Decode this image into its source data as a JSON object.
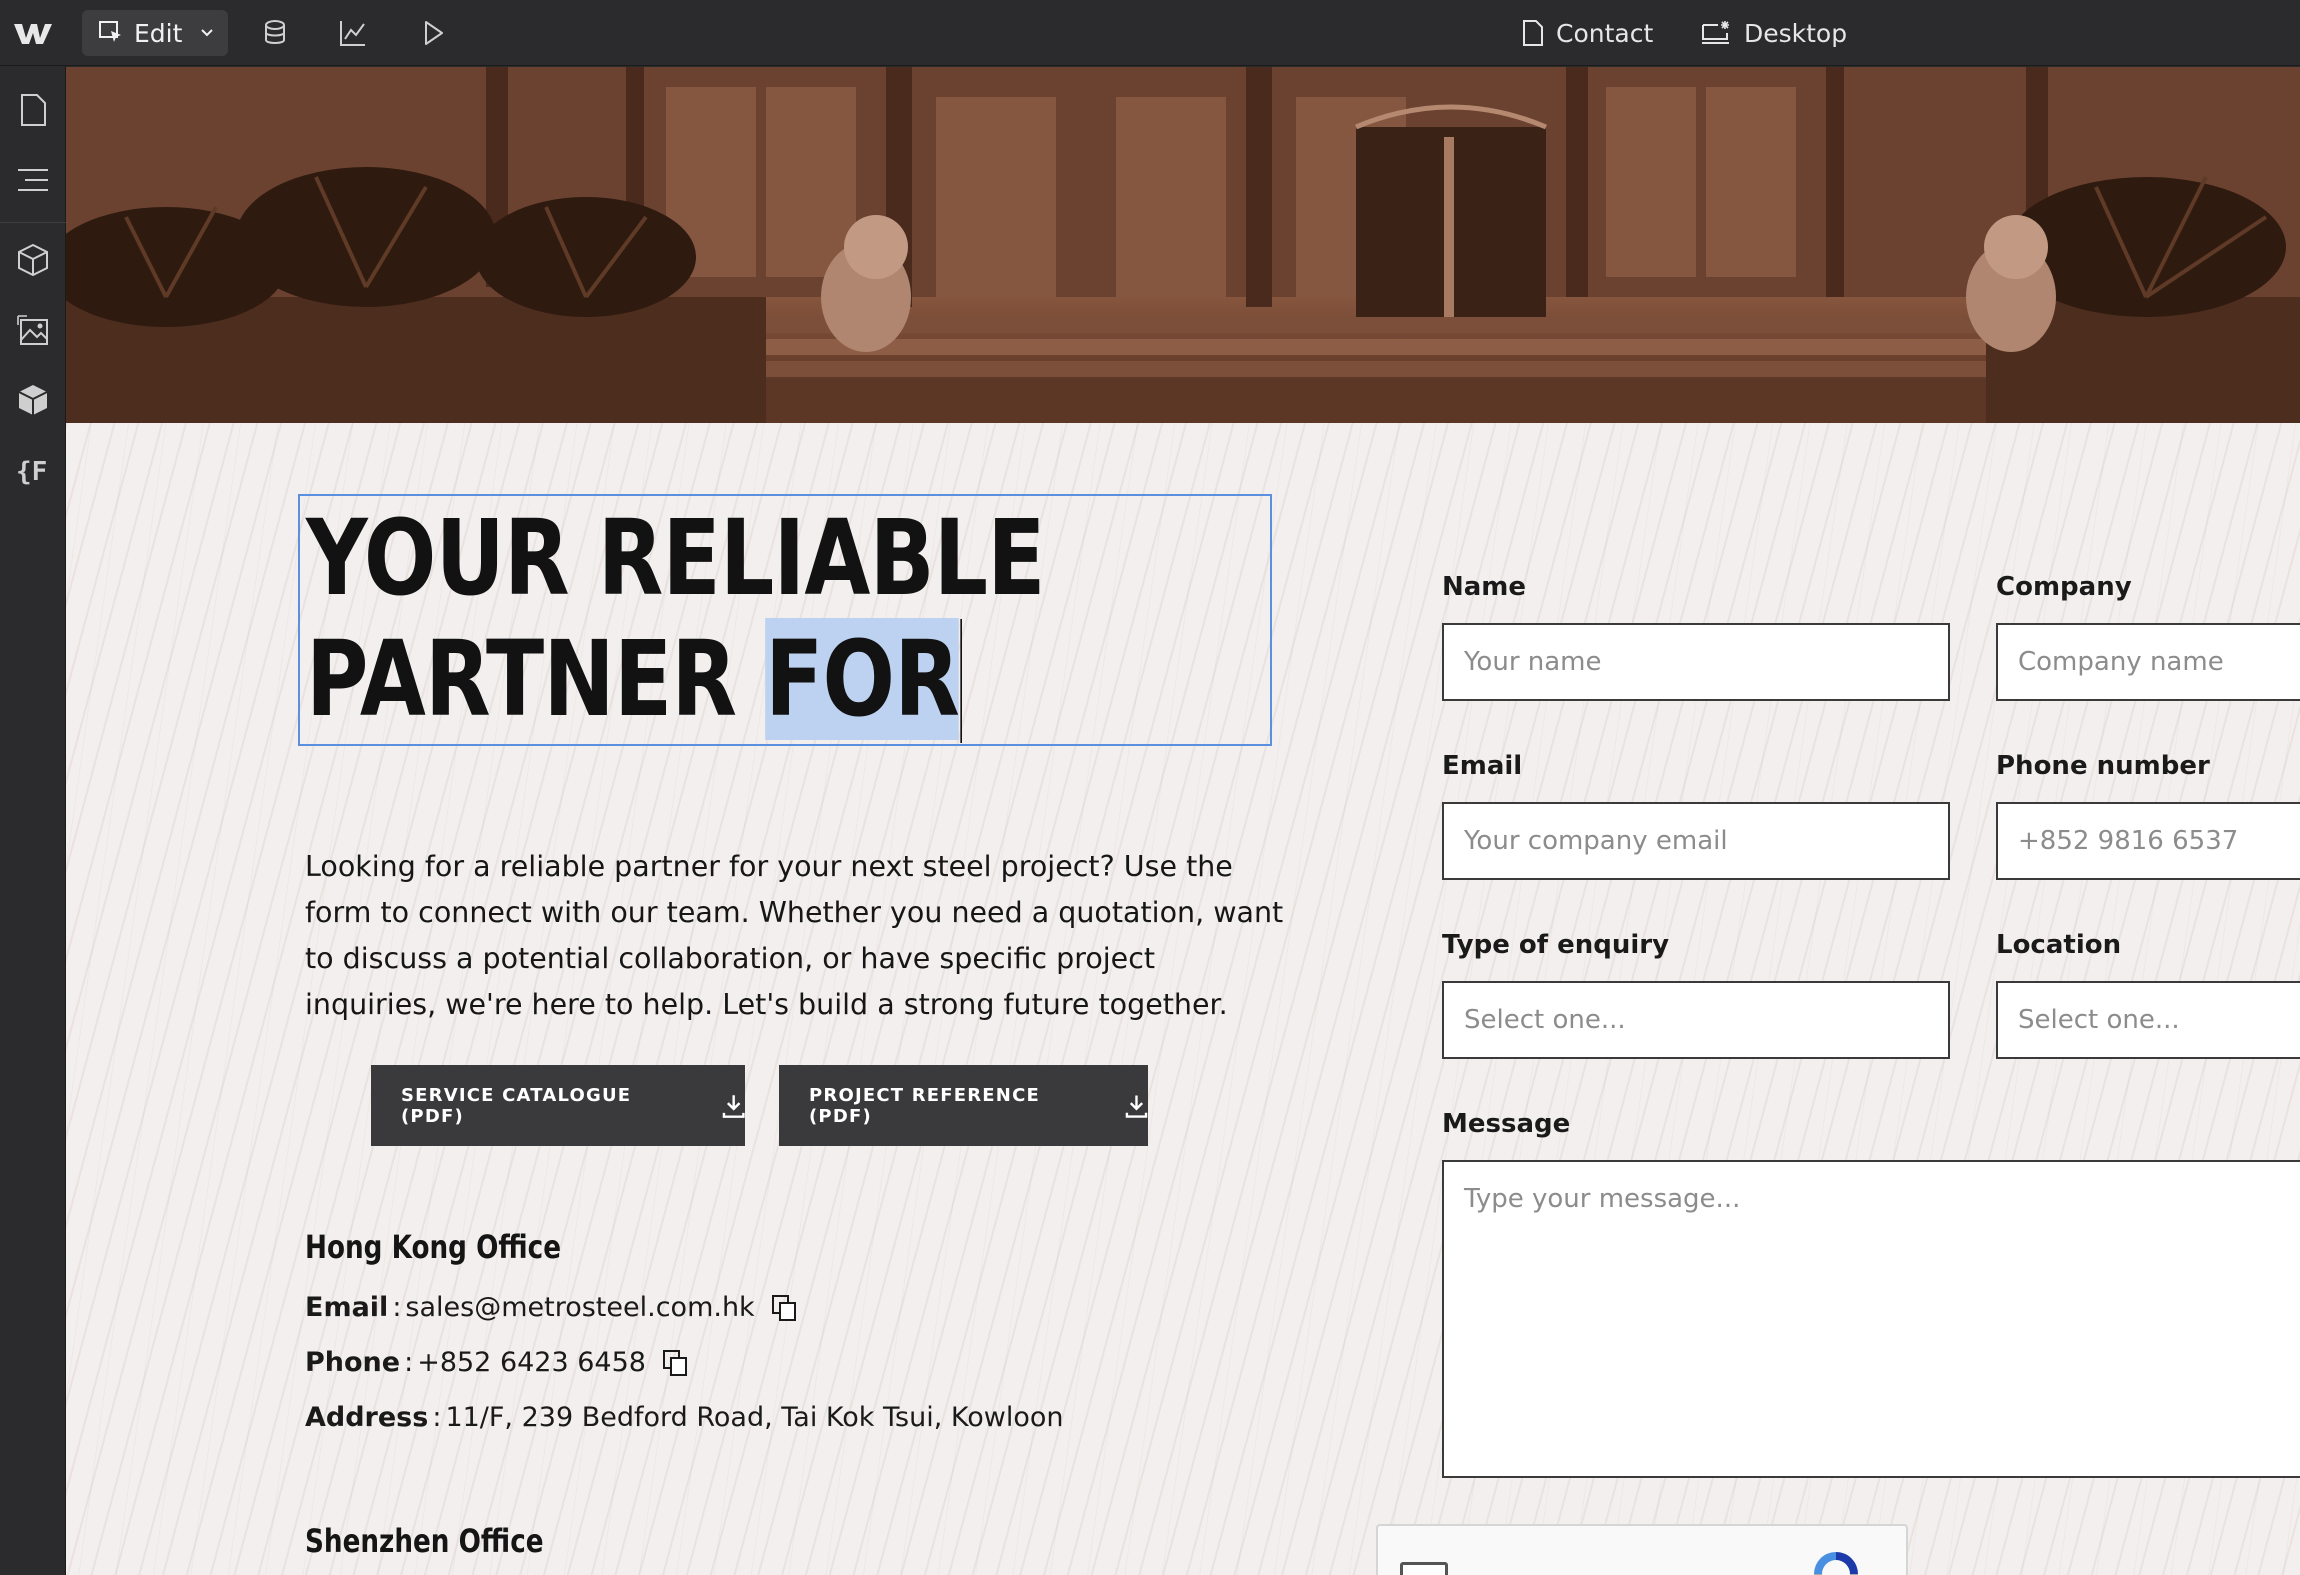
{
  "toolbar": {
    "mode_label": "Edit",
    "page_label": "Contact",
    "breakpoint_label": "Desktop"
  },
  "page": {
    "headline_line1": "YOUR RELIABLE",
    "headline_line2_plain": "PARTNER ",
    "headline_line2_selected": "FOR",
    "intro": "Looking for a reliable partner for your next steel project? Use the form to connect with our team. Whether you need a quotation, want to discuss a potential collaboration, or have specific project inquiries, we're here to help. Let's build a strong future together.",
    "buttons": {
      "catalogue": "SERVICE CATALOGUE (PDF)",
      "reference": "PROJECT REFERENCE (PDF)"
    },
    "hk_office": {
      "title": "Hong Kong Office",
      "email_label": "Email",
      "email": "sales@metrosteel.com.hk",
      "phone_label": "Phone",
      "phone": "+852 6423 6458",
      "address_label": "Address",
      "address": "11/F, 239 Bedford Road, Tai Kok Tsui, Kowloon"
    },
    "sz_office": {
      "title": "Shenzhen Office"
    }
  },
  "form": {
    "name_label": "Name",
    "name_placeholder": "Your name",
    "company_label": "Company",
    "company_placeholder": "Company name",
    "email_label": "Email",
    "email_placeholder": "Your company email",
    "phone_label": "Phone number",
    "phone_placeholder": "+852 9816 6537",
    "enquiry_label": "Type of enquiry",
    "enquiry_placeholder": "Select one...",
    "location_label": "Location",
    "location_placeholder": "Select one...",
    "message_label": "Message",
    "message_placeholder": "Type your message..."
  },
  "colors": {
    "chrome": "#2b2b2d",
    "selection": "#5b8fe0",
    "button": "#3a3a3c"
  }
}
